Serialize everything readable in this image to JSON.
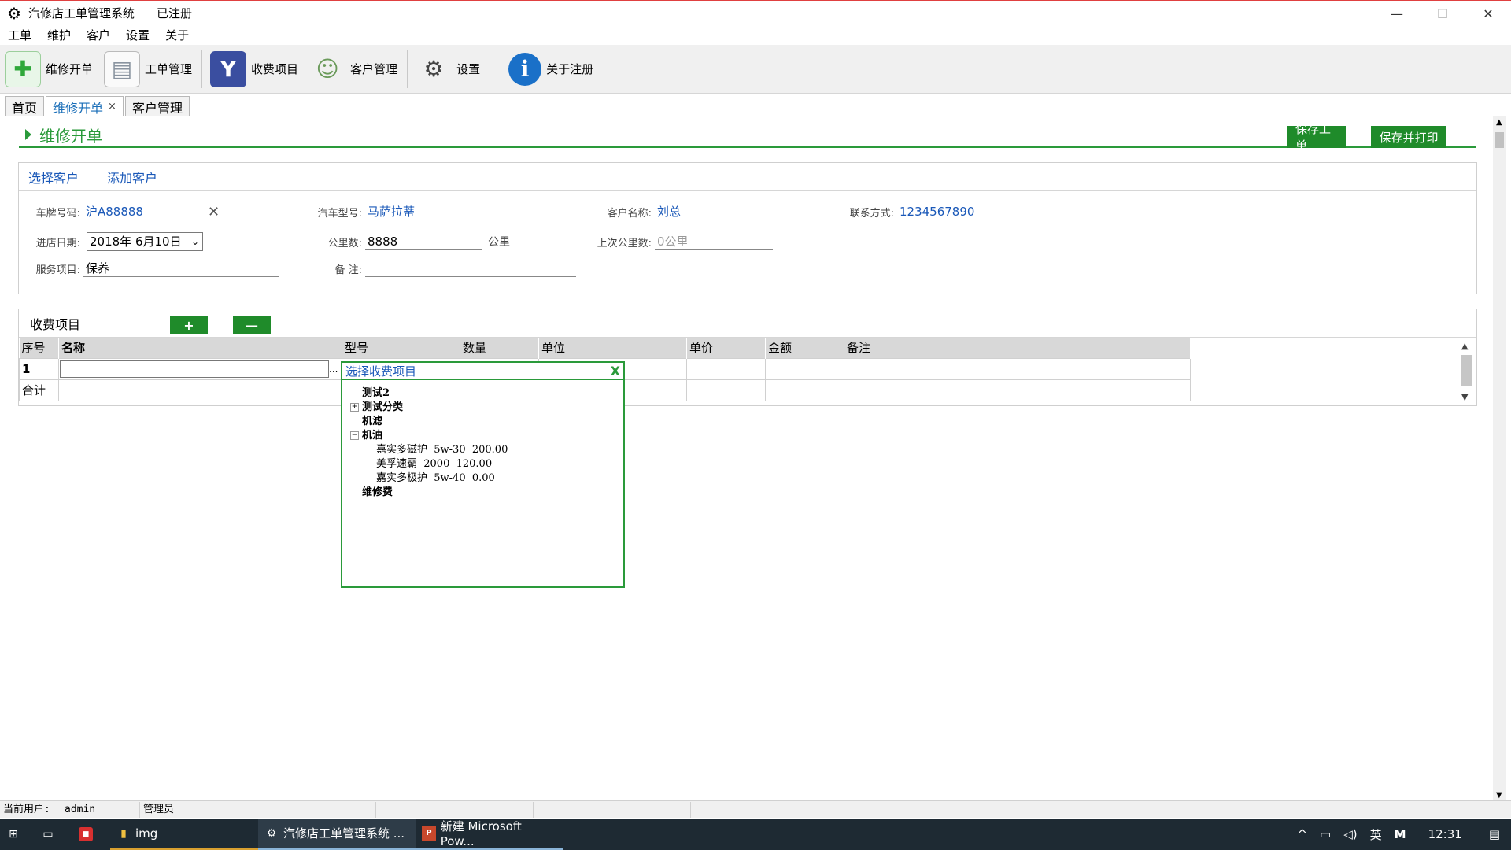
{
  "window": {
    "title": "汽修店工单管理系统",
    "registered": "已注册",
    "controls": {
      "minimize": "—",
      "maximize": "☐",
      "close": "✕"
    }
  },
  "menu": [
    "工单",
    "维护",
    "客户",
    "设置",
    "关于"
  ],
  "toolbar": [
    {
      "label": "维修开单",
      "icon": "new-order-icon",
      "glyph": "✚",
      "color": "#2fa83a"
    },
    {
      "label": "工单管理",
      "icon": "document-icon",
      "glyph": "▤",
      "color": "#9aa4b0"
    },
    {
      "label": "收费项目",
      "icon": "yahoo-y-icon",
      "glyph": "Y",
      "color": "#3a4ea0"
    },
    {
      "label": "客户管理",
      "icon": "user-icon",
      "glyph": "☺",
      "color": "#7aa86a"
    },
    {
      "label": "设置",
      "icon": "gear-icon",
      "glyph": "⚙",
      "color": "#444444"
    },
    {
      "label": "关于注册",
      "icon": "info-icon",
      "glyph": "i",
      "color": "#1a70c8"
    }
  ],
  "tabs": [
    {
      "label": "首页",
      "active": false
    },
    {
      "label": "维修开单",
      "active": true,
      "close": "×"
    },
    {
      "label": "客户管理",
      "active": false
    }
  ],
  "page": {
    "title": "维修开单",
    "save_label": "保存工单",
    "save_print_label": "保存并打印"
  },
  "customer": {
    "select_label": "选择客户",
    "add_label": "添加客户",
    "fields": {
      "plate_label": "车牌号码:",
      "plate_value": "沪A88888",
      "model_label": "汽车型号:",
      "model_value": "马萨拉蒂",
      "name_label": "客户名称:",
      "name_value": "刘总",
      "contact_label": "联系方式:",
      "contact_value": "1234567890",
      "date_label": "进店日期:",
      "date_value": "2018年  6月10日",
      "mileage_label": "公里数:",
      "mileage_value": "8888",
      "mileage_unit": "公里",
      "last_mileage_label": "上次公里数:",
      "last_mileage_placeholder": "0公里",
      "service_label": "服务项目:",
      "service_value": "保养",
      "note_label": "备    注:",
      "note_value": ""
    }
  },
  "fee": {
    "title": "收费项目",
    "add": "+",
    "remove": "—",
    "columns": [
      "序号",
      "名称",
      "型号",
      "数量",
      "单位",
      "单价",
      "金额",
      "备注"
    ],
    "row_index": "1",
    "ellipsis": "...",
    "total_label": "合计"
  },
  "popup": {
    "title": "选择收费项目",
    "close": "X",
    "tree": [
      {
        "label": "测试2",
        "level": 0,
        "expander": "",
        "bold": true
      },
      {
        "label": "测试分类",
        "level": 0,
        "expander": "+",
        "bold": true
      },
      {
        "label": "机滤",
        "level": 0,
        "expander": "",
        "bold": true
      },
      {
        "label": "机油",
        "level": 0,
        "expander": "−",
        "bold": true
      },
      {
        "label": "嘉实多磁护  5w-30  200.00",
        "level": 1,
        "expander": "",
        "bold": false
      },
      {
        "label": "美孚速霸  2000  120.00",
        "level": 1,
        "expander": "",
        "bold": false
      },
      {
        "label": "嘉实多极护  5w-40  0.00",
        "level": 1,
        "expander": "",
        "bold": false
      },
      {
        "label": "维修费",
        "level": 0,
        "expander": "",
        "bold": true
      }
    ]
  },
  "status": {
    "user_label": "当前用户:",
    "user_value": "admin",
    "role": "管理员"
  },
  "taskbar": {
    "items": [
      {
        "label": "img",
        "icon": "folder-icon"
      },
      {
        "label": "汽修店工单管理系统 ...",
        "icon": "gear-icon",
        "active": true
      },
      {
        "label": "新建 Microsoft Pow...",
        "icon": "powerpoint-icon"
      }
    ],
    "ime": "英",
    "ime2": "M",
    "time": "12:31"
  }
}
